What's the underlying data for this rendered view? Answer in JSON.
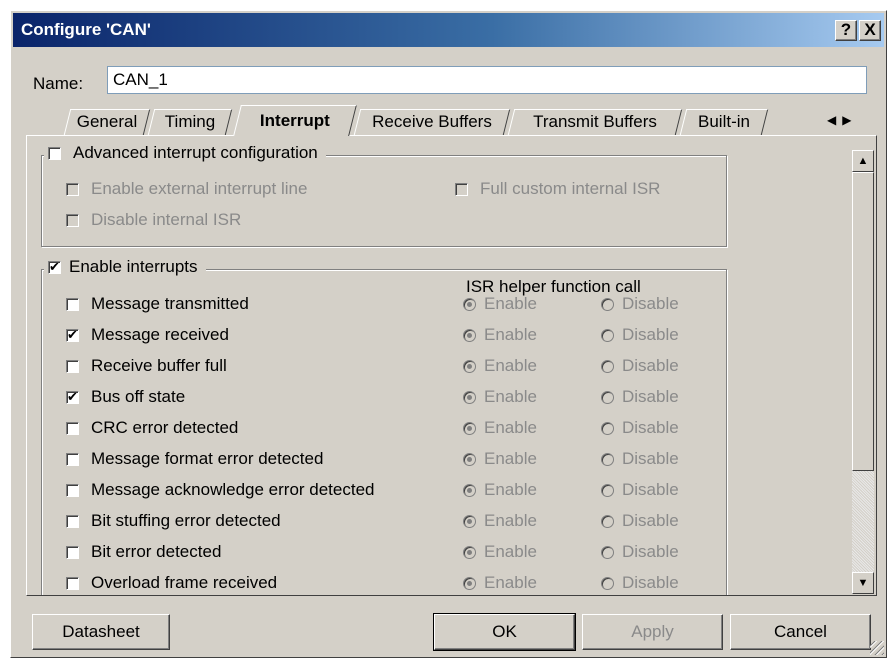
{
  "window": {
    "title": "Configure 'CAN'",
    "help_label": "?",
    "close_label": "X"
  },
  "name": {
    "label": "Name:",
    "value": "CAN_1"
  },
  "tabs": [
    {
      "label": "General",
      "active": false
    },
    {
      "label": "Timing",
      "active": false
    },
    {
      "label": "Interrupt",
      "active": true
    },
    {
      "label": "Receive Buffers",
      "active": false
    },
    {
      "label": "Transmit Buffers",
      "active": false
    },
    {
      "label": "Built-in",
      "active": false
    }
  ],
  "tab_scroll": {
    "left": "◀",
    "right": "▶"
  },
  "advanced": {
    "title": "Advanced interrupt configuration",
    "checked": false,
    "options": [
      {
        "label": "Enable external interrupt line",
        "checked": false
      },
      {
        "label": "Full custom internal ISR",
        "checked": false
      },
      {
        "label": "Disable internal ISR",
        "checked": false
      }
    ]
  },
  "interrupts": {
    "title": "Enable interrupts",
    "checked": true,
    "isr_header": "ISR helper function call",
    "enable_label": "Enable",
    "disable_label": "Disable",
    "items": [
      {
        "label": "Message transmitted",
        "checked": false
      },
      {
        "label": "Message received",
        "checked": true
      },
      {
        "label": "Receive buffer full",
        "checked": false
      },
      {
        "label": "Bus off state",
        "checked": true
      },
      {
        "label": "CRC error detected",
        "checked": false
      },
      {
        "label": "Message format error detected",
        "checked": false
      },
      {
        "label": "Message acknowledge error detected",
        "checked": false
      },
      {
        "label": "Bit stuffing error detected",
        "checked": false
      },
      {
        "label": "Bit error detected",
        "checked": false
      },
      {
        "label": "Overload frame received",
        "checked": false
      }
    ]
  },
  "buttons": {
    "datasheet": "Datasheet",
    "ok": "OK",
    "apply": "Apply",
    "cancel": "Cancel"
  },
  "icons": {
    "check_mark": "✔",
    "scroll_up": "▲",
    "scroll_down": "▼"
  }
}
